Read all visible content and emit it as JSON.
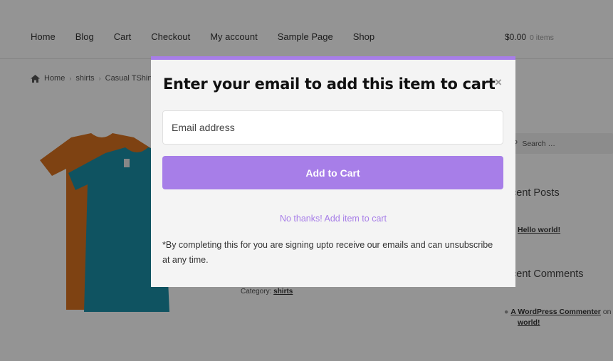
{
  "header": {
    "nav": [
      "Home",
      "Blog",
      "Cart",
      "Checkout",
      "My account",
      "Sample Page",
      "Shop"
    ],
    "cart_amount": "$0.00",
    "cart_count": "0 items"
  },
  "breadcrumb": [
    "Home",
    "shirts",
    "Casual TShirt"
  ],
  "product": {
    "category_label": "Category:",
    "category_value": "shirts"
  },
  "sidebar": {
    "search_placeholder": "Search …",
    "recent_posts_heading": "cent Posts",
    "recent_post_link": "Hello world!",
    "recent_comments_heading": "cent Comments",
    "comment_author": "A WordPress Commenter",
    "comment_on": "on",
    "comment_post": "world!"
  },
  "modal": {
    "title": "Enter your email to add this item to cart",
    "close_symbol": "×",
    "email_placeholder": "Email address",
    "add_button": "Add to Cart",
    "no_thanks": "No thanks! Add item to cart",
    "disclaimer": "*By completing this for you are signing upto receive our emails and can unsubscribe at any time."
  },
  "colors": {
    "accent": "#a77ee8",
    "overlay": "rgba(0,0,0,0.42)",
    "shirt_orange": "#d9731f",
    "shirt_teal": "#1b8fa8"
  }
}
